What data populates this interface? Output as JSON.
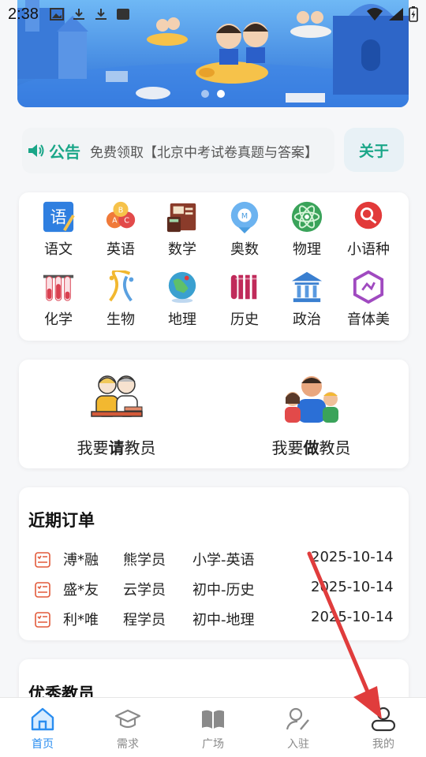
{
  "status_bar": {
    "time": "2:38"
  },
  "banner": {
    "slides": 2,
    "active_slide": 2
  },
  "notice": {
    "label": "公告",
    "text": "免费领取【北京中考试卷真题与答案】",
    "about_label": "关于"
  },
  "subjects": [
    {
      "label": "语文",
      "icon": "chinese-book-icon",
      "color": "#2f7fe0"
    },
    {
      "label": "英语",
      "icon": "abc-balloons-icon",
      "color": "#f07a3a"
    },
    {
      "label": "数学",
      "icon": "calculator-board-icon",
      "color": "#8a3b2a"
    },
    {
      "label": "奥数",
      "icon": "medal-icon",
      "color": "#4a9de0"
    },
    {
      "label": "物理",
      "icon": "atom-icon",
      "color": "#3aa35a"
    },
    {
      "label": "小语种",
      "icon": "speech-pin-icon",
      "color": "#e23a3a"
    },
    {
      "label": "化学",
      "icon": "test-tubes-icon",
      "color": "#d94050"
    },
    {
      "label": "生物",
      "icon": "dna-icon",
      "color": "#f2b830"
    },
    {
      "label": "地理",
      "icon": "globe-icon",
      "color": "#3aa0d0"
    },
    {
      "label": "历史",
      "icon": "scroll-icon",
      "color": "#c02a5a"
    },
    {
      "label": "政治",
      "icon": "government-building-icon",
      "color": "#3a7fd0"
    },
    {
      "label": "音体美",
      "icon": "hexagon-art-icon",
      "color": "#a04ac0"
    }
  ],
  "teacher": {
    "hire": {
      "prefix": "我要",
      "bold": "请",
      "suffix": "教员"
    },
    "become": {
      "prefix": "我要",
      "bold": "做",
      "suffix": "教员"
    }
  },
  "orders": {
    "title": "近期订单",
    "rows": [
      {
        "name": "溥*融",
        "student": "熊学员",
        "subject": "小学-英语",
        "date": "2025-10-14"
      },
      {
        "name": "盛*友",
        "student": "云学员",
        "subject": "初中-历史",
        "date": "2025-10-14"
      },
      {
        "name": "利*唯",
        "student": "程学员",
        "subject": "初中-地理",
        "date": "2025-10-14"
      }
    ]
  },
  "excellent": {
    "title": "优秀教员"
  },
  "nav": [
    {
      "label": "首页",
      "icon": "home-icon",
      "active": true
    },
    {
      "label": "需求",
      "icon": "graduation-cap-icon",
      "active": false
    },
    {
      "label": "广场",
      "icon": "open-book-icon",
      "active": false
    },
    {
      "label": "入驻",
      "icon": "user-edit-icon",
      "active": false
    },
    {
      "label": "我的",
      "icon": "user-profile-icon",
      "active": false
    }
  ],
  "colors": {
    "accent": "#1aa688",
    "nav_active": "#2a8df0",
    "arrow": "#e03c3c"
  }
}
